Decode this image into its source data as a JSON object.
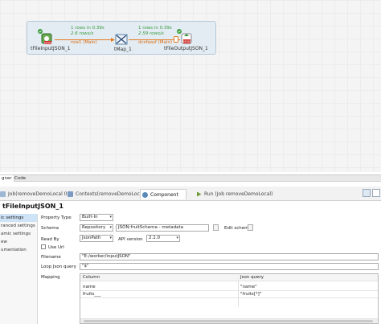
{
  "canvas": {
    "nodes": [
      {
        "label": "tFileInputJSON_1",
        "icon": "json-input-icon"
      },
      {
        "label": "tMap_1",
        "icon": "tmap-icon"
      },
      {
        "label": "tFileOutputJSON_1",
        "icon": "json-output-icon"
      }
    ],
    "flows": [
      {
        "rows": "1 rows in 0.39s",
        "rate": "2.6 rows/s",
        "name": "row1 (Main)"
      },
      {
        "rows": "1 rows in 0.39s",
        "rate": "2.59 rows/s",
        "name": "dcsfeasf (Main)"
      }
    ]
  },
  "designer_tabs": {
    "designer": "gner",
    "code": "Code"
  },
  "view_tabs": [
    {
      "label": "Job(removeDemoLocal 0.1)",
      "active": false
    },
    {
      "label": "Contexts(removeDemoLocal)",
      "active": false
    },
    {
      "label": "Component",
      "active": true
    },
    {
      "label": "Run (Job removeDemoLocal)",
      "active": false
    }
  ],
  "component_title": "tFileInputJSON_1",
  "sidebar": {
    "items": [
      {
        "label": "ic settings",
        "selected": true
      },
      {
        "label": "ranced settings",
        "selected": false
      },
      {
        "label": "amic settings",
        "selected": false
      },
      {
        "label": "ew",
        "selected": false
      },
      {
        "label": "umentation",
        "selected": false
      }
    ]
  },
  "form": {
    "property_type": {
      "label": "Property Type",
      "value": "Built-In"
    },
    "schema": {
      "label": "Schema",
      "type_value": "Repository",
      "schema_value": "JSON:fruitSchema - metadata",
      "edit_label": "Edit schema"
    },
    "read_by": {
      "label": "Read By",
      "value": "JsonPath",
      "api_label": "API version",
      "api_value": "2.1.0"
    },
    "use_url": {
      "label": "Use Url"
    },
    "filename": {
      "label": "Filename",
      "value": "\"E:/worker/inputJSON\""
    },
    "loop_query": {
      "label": "Loop Json query",
      "value": "\"$\""
    },
    "mapping": {
      "label": "Mapping",
      "headers": [
        "Column",
        "Json query"
      ],
      "rows": [
        [
          "name",
          "\"name\""
        ],
        [
          "fruits___",
          "\"fruits[*]\""
        ]
      ]
    }
  },
  "colors": {
    "accent": "#e47a1f",
    "success": "#3a9b3a",
    "selection": "#cfe3f7"
  }
}
